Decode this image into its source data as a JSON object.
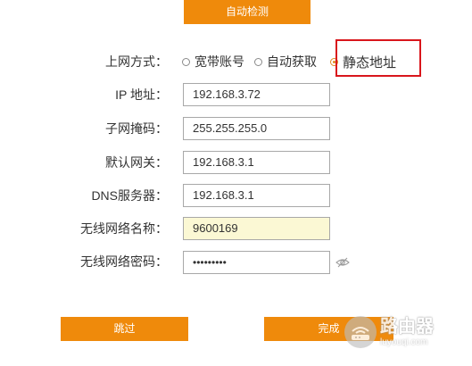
{
  "top_button": {
    "label": "自动检测"
  },
  "form": {
    "connection_type": {
      "label": "上网方式：",
      "options": [
        {
          "label": "宽带账号",
          "checked": false
        },
        {
          "label": "自动获取",
          "checked": false
        },
        {
          "label": "静态地址",
          "checked": true
        }
      ]
    },
    "ip": {
      "label": "IP 地址：",
      "value": "192.168.3.72"
    },
    "subnet": {
      "label": "子网掩码：",
      "value": "255.255.255.0"
    },
    "gateway": {
      "label": "默认网关：",
      "value": "192.168.3.1"
    },
    "dns": {
      "label": "DNS服务器：",
      "value": "192.168.3.1"
    },
    "ssid": {
      "label": "无线网络名称：",
      "value": "9600169"
    },
    "wifi_password": {
      "label": "无线网络密码：",
      "value": "•••••••••"
    }
  },
  "buttons": {
    "skip_label": "跳过",
    "finish_label": "完成"
  },
  "watermark": {
    "main": "路由器",
    "sub": "luyouqi.com"
  },
  "colors": {
    "accent": "#ef8a0b",
    "highlight": "#d9161c",
    "input_yellow": "#fbf8d4"
  }
}
